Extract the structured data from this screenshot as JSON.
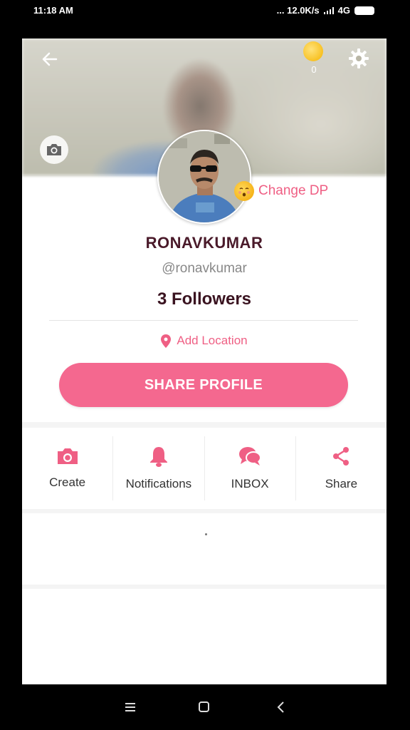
{
  "status_bar": {
    "time": "11:18 AM",
    "right_text": "... 12.0K/s",
    "network": "4G"
  },
  "header": {
    "coin_count": "0"
  },
  "profile": {
    "change_dp_label": "Change DP",
    "name": "RONAVKUMAR",
    "handle": "@ronavkumar",
    "followers": "3 Followers",
    "location_label": "Add Location",
    "share_profile_label": "SHARE PROFILE"
  },
  "actions": [
    {
      "label": "Create",
      "icon": "camera-icon"
    },
    {
      "label": "Notifications",
      "icon": "bell-icon"
    },
    {
      "label": "INBOX",
      "icon": "chat-bubbles-icon"
    },
    {
      "label": "Share",
      "icon": "share-icon"
    }
  ],
  "colors": {
    "accent": "#f4688f",
    "accent_text": "#ef5f84",
    "name_text": "#4a1a2a"
  },
  "nav_bar": {
    "icons": [
      "menu-icon",
      "home-square-icon",
      "back-chevron-icon"
    ]
  }
}
